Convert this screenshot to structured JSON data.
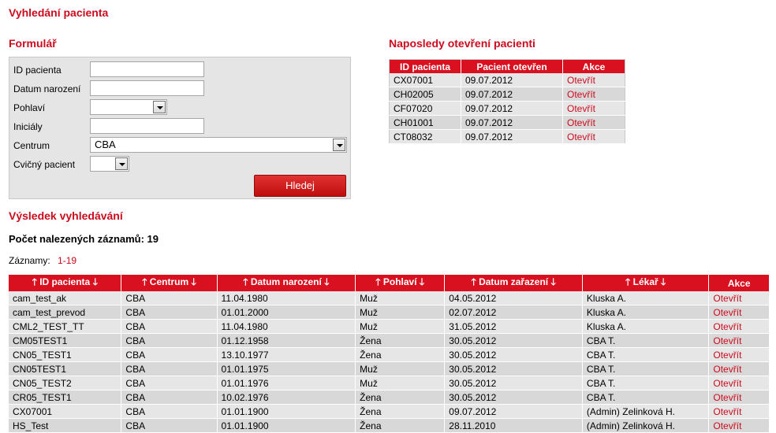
{
  "page_title": "Vyhledání pacienta",
  "form": {
    "title": "Formulář",
    "fields": {
      "patient_id": {
        "label": "ID pacienta",
        "value": ""
      },
      "birth_date": {
        "label": "Datum narození",
        "value": ""
      },
      "sex": {
        "label": "Pohlaví",
        "value": ""
      },
      "initials": {
        "label": "Iniciály",
        "value": ""
      },
      "center": {
        "label": "Centrum",
        "value": "CBA"
      },
      "training": {
        "label": "Cvičný pacient",
        "value": ""
      }
    },
    "search_label": "Hledej"
  },
  "recent": {
    "title": "Naposledy otevření pacienti",
    "columns": [
      "ID pacienta",
      "Pacient otevřen",
      "Akce"
    ],
    "rows": [
      [
        "CX07001",
        "09.07.2012",
        "Otevřít"
      ],
      [
        "CH02005",
        "09.07.2012",
        "Otevřít"
      ],
      [
        "CF07020",
        "09.07.2012",
        "Otevřít"
      ],
      [
        "CH01001",
        "09.07.2012",
        "Otevřít"
      ],
      [
        "CT08032",
        "09.07.2012",
        "Otevřít"
      ]
    ]
  },
  "results": {
    "title": "Výsledek vyhledávání",
    "count_text": "Počet nalezených záznamů: 19",
    "records_label": "Záznamy:",
    "records_range": "1-19",
    "sort_up": "🡑",
    "sort_down": "🡓",
    "columns": [
      "ID pacienta",
      "Centrum",
      "Datum narození",
      "Pohlaví",
      "Datum zařazení",
      "Lékař",
      "Akce"
    ],
    "rows": [
      [
        "cam_test_ak",
        "CBA",
        "11.04.1980",
        "Muž",
        "04.05.2012",
        "Kluska A.",
        "Otevřít"
      ],
      [
        "cam_test_prevod",
        "CBA",
        "01.01.2000",
        "Muž",
        "02.07.2012",
        "Kluska A.",
        "Otevřít"
      ],
      [
        "CML2_TEST_TT",
        "CBA",
        "11.04.1980",
        "Muž",
        "31.05.2012",
        "Kluska A.",
        "Otevřít"
      ],
      [
        "CM05TEST1",
        "CBA",
        "01.12.1958",
        "Žena",
        "30.05.2012",
        "CBA T.",
        "Otevřít"
      ],
      [
        "CN05_TEST1",
        "CBA",
        "13.10.1977",
        "Žena",
        "30.05.2012",
        "CBA T.",
        "Otevřít"
      ],
      [
        "CN05TEST1",
        "CBA",
        "01.01.1975",
        "Muž",
        "30.05.2012",
        "CBA T.",
        "Otevřít"
      ],
      [
        "CN05_TEST2",
        "CBA",
        "01.01.1976",
        "Muž",
        "30.05.2012",
        "CBA T.",
        "Otevřít"
      ],
      [
        "CR05_TEST1",
        "CBA",
        "10.02.1976",
        "Žena",
        "30.05.2012",
        "CBA T.",
        "Otevřít"
      ],
      [
        "CX07001",
        "CBA",
        "01.01.1900",
        "Žena",
        "09.07.2012",
        "(Admin) Zelinková H.",
        "Otevřít"
      ],
      [
        "HS_Test",
        "CBA",
        "01.01.1900",
        "Žena",
        "28.11.2010",
        "(Admin) Zelinková H.",
        "Otevřít"
      ]
    ]
  },
  "colors": {
    "accent": "#cc0b1e",
    "header_bg": "#d8101f",
    "row_odd": "#e6e6e6",
    "row_even": "#d8d8d8"
  }
}
